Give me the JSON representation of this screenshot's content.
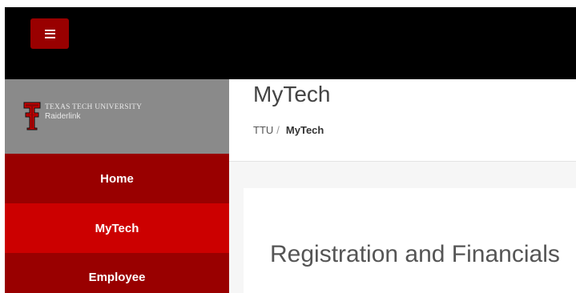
{
  "topbar": {
    "menu_button_icon": "hamburger-menu-icon",
    "colors": {
      "bar": "#000000",
      "button": "#990000"
    }
  },
  "sidebar": {
    "brand": {
      "logo_icon": "double-t-logo-icon",
      "university": "TEXAS TECH UNIVERSITY",
      "portal": "Raiderlink"
    },
    "items": [
      {
        "label": "Home",
        "active": false
      },
      {
        "label": "MyTech",
        "active": true
      },
      {
        "label": "Employee",
        "active": false
      }
    ],
    "colors": {
      "brand_bg": "#8a8a8a",
      "item": "#990000",
      "active_item": "#cc0000"
    }
  },
  "main": {
    "title": "MyTech",
    "breadcrumb": {
      "root": "TTU",
      "separator": "/",
      "current": "MyTech"
    },
    "section_heading": "Registration and Financials"
  }
}
